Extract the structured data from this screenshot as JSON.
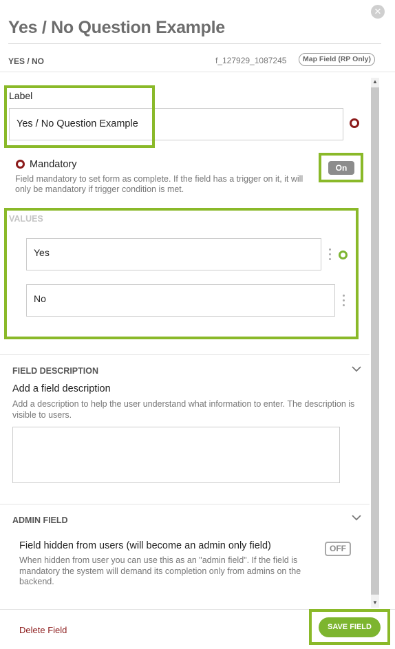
{
  "header": {
    "title": "Yes / No Question Example",
    "close_icon": "✕",
    "field_type": "YES / NO",
    "field_id": "f_127929_1087245",
    "map_field_label": "Map Field (RP Only)"
  },
  "label_section": {
    "label": "Label",
    "value": "Yes / No Question Example"
  },
  "mandatory": {
    "label": "Mandatory",
    "description": "Field mandatory to set form as complete. If the field has a trigger on it, it will only be mandatory if trigger condition is met.",
    "toggle": "On"
  },
  "values_section": {
    "heading": "VALUES",
    "items": [
      {
        "value": "Yes"
      },
      {
        "value": "No"
      }
    ]
  },
  "field_description": {
    "heading": "FIELD DESCRIPTION",
    "title": "Add a field description",
    "help": "Add a description to help the user understand what information to enter. The description is visible to users.",
    "value": ""
  },
  "admin_field": {
    "heading": "ADMIN FIELD",
    "title": "Field hidden from users (will become an admin only field)",
    "description": "When hidden from user you can use this as an \"admin field\". If the field is mandatory the system will demand its completion only from admins on the backend.",
    "toggle": "OFF"
  },
  "footer": {
    "delete_label": "Delete Field",
    "save_label": "SAVE FIELD"
  },
  "colors": {
    "accent_green": "#7db52f",
    "highlight_green": "#8ab929",
    "danger_red": "#8b1a1a",
    "toggle_gray": "#8c8c8c"
  },
  "icons": {
    "close": "close-icon",
    "chevron": "chevron-down-icon",
    "kebab": "kebab-menu-icon",
    "indicator": "status-dot-icon"
  }
}
